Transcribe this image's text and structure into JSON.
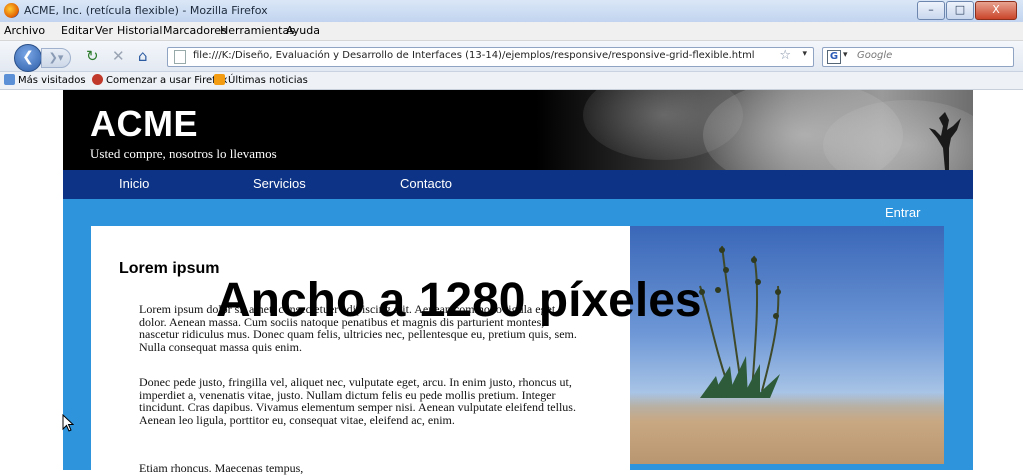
{
  "window": {
    "title": "ACME, Inc. (retícula flexible) - Mozilla Firefox",
    "controls": [
      "–",
      "□",
      "X"
    ]
  },
  "menubar": {
    "items": [
      "Archivo",
      "Editar",
      "Ver",
      "Historial",
      "Marcadores",
      "Herramientas",
      "Ayuda"
    ]
  },
  "navbar": {
    "url": "file:///K:/Diseño, Evaluación y Desarrollo de Interfaces (13-14)/ejemplos/responsive/responsive-grid-flexible.html",
    "search_engine_letter": "G",
    "search_placeholder": "Google"
  },
  "bookmarks": {
    "items": [
      "Más visitados",
      "Comenzar a usar Firefox",
      "Últimas noticias"
    ]
  },
  "site": {
    "logo": "ACME",
    "tagline": "Usted compre, nosotros lo llevamos",
    "nav": [
      "Inicio",
      "Servicios",
      "Contacto"
    ],
    "login": "Entrar",
    "article": {
      "heading": "Lorem ipsum",
      "paragraph1": "Lorem ipsum dolor sit amet, consectetuer adipiscing elit. Aenean commodo ligula eget dolor. Aenean massa. Cum sociis natoque penatibus et magnis dis parturient montes, nascetur ridiculus mus. Donec quam felis, ultricies nec, pellentesque eu, pretium quis, sem. Nulla consequat massa quis enim.",
      "paragraph2": "Donec pede justo, fringilla vel, aliquet nec, vulputate eget, arcu. In enim justo, rhoncus ut, imperdiet a, venenatis vitae, justo. Nullam dictum felis eu pede mollis pretium. Integer tincidunt. Cras dapibus. Vivamus elementum semper nisi. Aenean vulputate eleifend tellus. Aenean leo ligula, porttitor eu, consequat vitae, eleifend ac, enim.",
      "paragraph3": "Etiam rhoncus. Maecenas tempus,"
    }
  },
  "overlay_caption": "Ancho a 1280 píxeles",
  "colors": {
    "nav_bg": "#0c3386",
    "accent_blue": "#2e95dd",
    "header_bg": "#000000"
  }
}
